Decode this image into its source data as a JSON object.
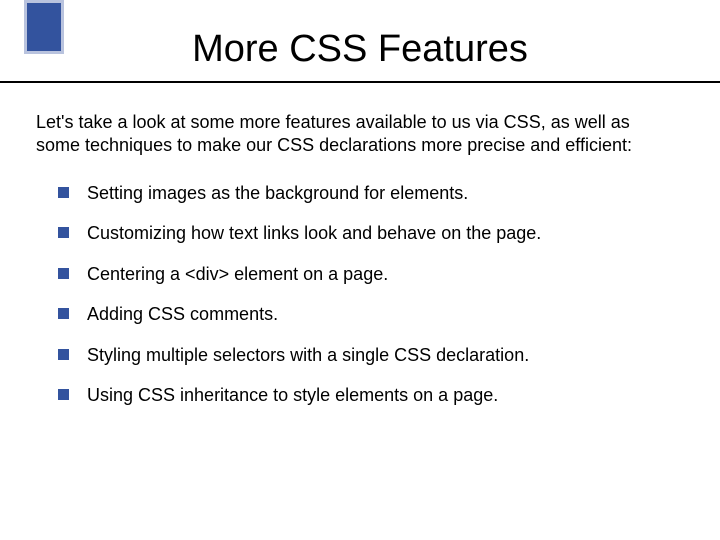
{
  "slide": {
    "title": "More CSS Features",
    "intro": "Let's take a look at some more features available to us via CSS, as well as some techniques to make our CSS declarations more precise and efficient:",
    "bullets": [
      "Setting images as the background for elements.",
      "Customizing how text links look and behave on the page.",
      "Centering a <div> element on a page.",
      "Adding CSS comments.",
      "Styling multiple selectors with a single CSS declaration.",
      "Using CSS inheritance to style elements on a page."
    ]
  }
}
